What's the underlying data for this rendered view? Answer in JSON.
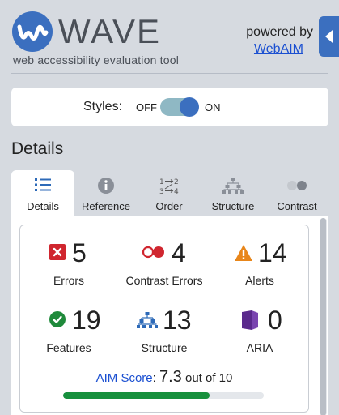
{
  "header": {
    "title": "WAVE",
    "tagline": "web accessibility evaluation tool",
    "powered_by": "powered by",
    "webaim_link": "WebAIM",
    "logo_icon": "wave-logo-icon",
    "collapse_icon": "chevron-left-icon"
  },
  "styles_toggle": {
    "label": "Styles:",
    "off": "OFF",
    "on": "ON",
    "state": "on"
  },
  "section_heading": "Details",
  "tabs": [
    {
      "label": "Details",
      "icon": "list-icon",
      "active": true
    },
    {
      "label": "Reference",
      "icon": "info-icon",
      "active": false
    },
    {
      "label": "Order",
      "icon": "order-arrows-icon",
      "active": false
    },
    {
      "label": "Structure",
      "icon": "hierarchy-icon",
      "active": false
    },
    {
      "label": "Contrast",
      "icon": "contrast-icon",
      "active": false
    }
  ],
  "summary": {
    "stats": [
      {
        "count": "5",
        "label": "Errors",
        "icon": "error-icon",
        "color": "#d0262f"
      },
      {
        "count": "4",
        "label": "Contrast Errors",
        "icon": "contrast-error-icon",
        "color": "#d0262f"
      },
      {
        "count": "14",
        "label": "Alerts",
        "icon": "alert-icon",
        "color": "#e8861a"
      },
      {
        "count": "19",
        "label": "Features",
        "icon": "feature-icon",
        "color": "#1f8a3b"
      },
      {
        "count": "13",
        "label": "Structure",
        "icon": "structure-icon",
        "color": "#2d6ab8"
      },
      {
        "count": "0",
        "label": "ARIA",
        "icon": "aria-icon",
        "color": "#5a2a8c"
      }
    ],
    "aim_score_link": "AIM Score",
    "aim_score_sep": ":",
    "aim_score_value": "7.3",
    "aim_score_suffix": "out of 10",
    "aim_score_fraction": 0.73
  },
  "colors": {
    "brand_blue": "#3b6fbf",
    "score_green": "#17903d"
  }
}
